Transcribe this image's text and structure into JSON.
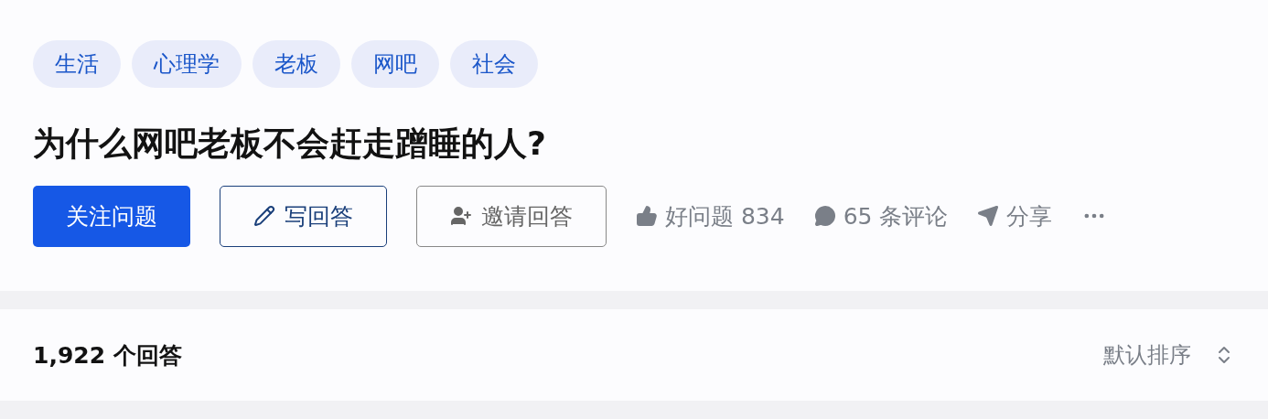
{
  "tags": [
    {
      "label": "生活"
    },
    {
      "label": "心理学"
    },
    {
      "label": "老板"
    },
    {
      "label": "网吧"
    },
    {
      "label": "社会"
    }
  ],
  "question": {
    "title": "为什么网吧老板不会赶走蹭睡的人?"
  },
  "actions": [
    {
      "kind": "follow",
      "label": "关注问题"
    },
    {
      "kind": "write",
      "label": "写回答"
    },
    {
      "kind": "invite",
      "label": "邀请回答"
    },
    {
      "kind": "like",
      "label": "好问题 834"
    },
    {
      "kind": "comment",
      "label": "65 条评论"
    },
    {
      "kind": "share",
      "label": "分享"
    },
    {
      "kind": "more"
    }
  ],
  "answers": {
    "count": "1,922 个回答",
    "sort": "默认排序"
  }
}
